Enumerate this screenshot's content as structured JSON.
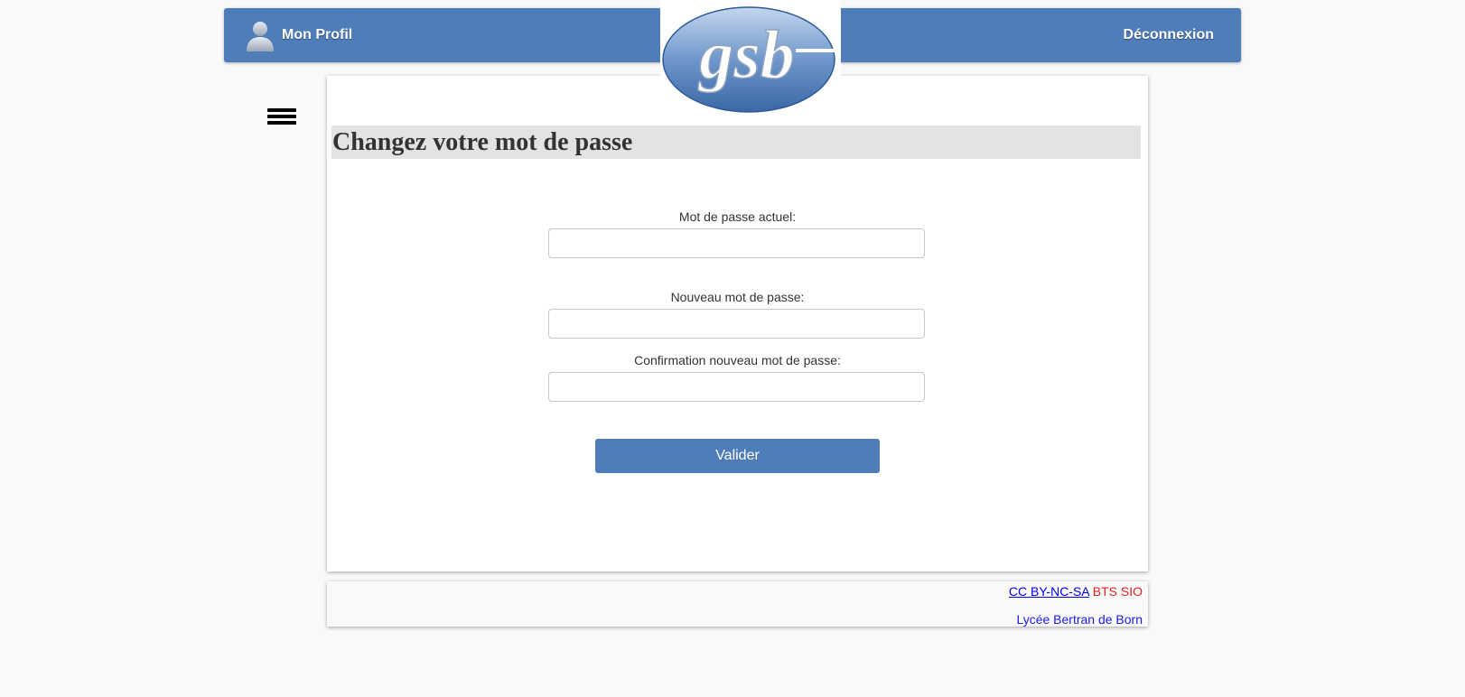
{
  "header": {
    "profile_label": "Mon Profil",
    "logout_label": "Déconnexion",
    "logo_text": "gsb",
    "accent_color": "#4f7dba"
  },
  "page": {
    "title": "Changez votre mot de passe"
  },
  "form": {
    "current_password_label": "Mot de passe actuel:",
    "current_password_value": "",
    "new_password_label": "Nouveau mot de passe:",
    "new_password_value": "",
    "confirm_password_label": "Confirmation nouveau mot de passe:",
    "confirm_password_value": "",
    "submit_label": "Valider"
  },
  "footer": {
    "license_link": "CC BY-NC-SA",
    "program": "BTS SIO",
    "school": "Lycée Bertran de Born"
  },
  "icons": [
    "user-icon",
    "hamburger-menu-icon",
    "gsb-logo"
  ]
}
